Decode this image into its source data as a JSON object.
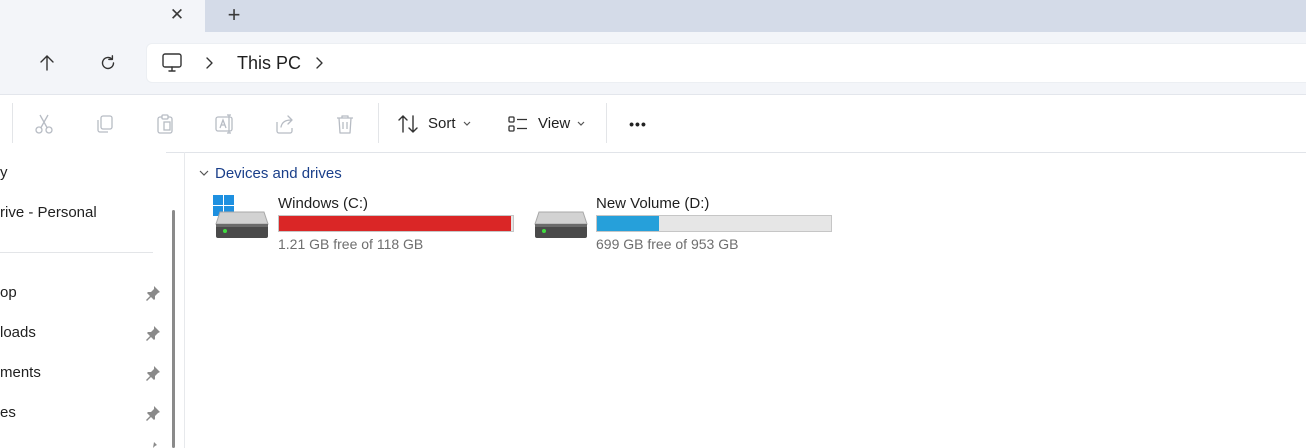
{
  "tabs": {
    "close_label": "✕",
    "new_label": "+"
  },
  "address": {
    "breadcrumb": [
      {
        "label": "This PC"
      }
    ]
  },
  "commandbar": {
    "sort_label": "Sort",
    "view_label": "View",
    "more_label": "•••"
  },
  "sidebar": {
    "items": [
      {
        "label": "y",
        "pinned": false
      },
      {
        "label": "rive - Personal",
        "pinned": false
      },
      {
        "label": "op",
        "pinned": true
      },
      {
        "label": "loads",
        "pinned": true
      },
      {
        "label": "ments",
        "pinned": true
      },
      {
        "label": "es",
        "pinned": true
      }
    ]
  },
  "content": {
    "group_title": "Devices and drives",
    "drives": [
      {
        "name": "Windows (C:)",
        "free_text": "1.21 GB free of 118 GB",
        "used_fraction": 0.99,
        "bar_color": "#da2626",
        "has_windows_logo": true
      },
      {
        "name": "New Volume (D:)",
        "free_text": "699 GB free of 953 GB",
        "used_fraction": 0.267,
        "bar_color": "#26a0da",
        "has_windows_logo": false
      }
    ]
  },
  "colors": {
    "accent": "#1a3f8a",
    "drive_full": "#da2626",
    "drive_ok": "#26a0da"
  }
}
